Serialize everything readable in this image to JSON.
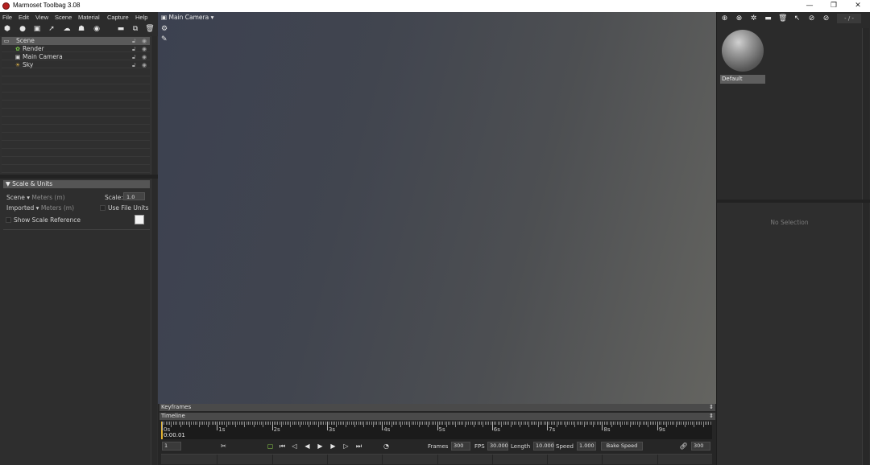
{
  "window": {
    "title": "Marmoset Toolbag 3.08",
    "controls": [
      "—",
      "❐",
      "✕"
    ]
  },
  "menu": [
    "File",
    "Edit",
    "View",
    "Scene",
    "Material",
    "Capture",
    "Help"
  ],
  "scene_tree": {
    "nodes": [
      {
        "label": "Scene",
        "icon": "scene-icon",
        "selected": true
      },
      {
        "label": "Render",
        "icon": "render-icon"
      },
      {
        "label": "Main Camera",
        "icon": "camera-icon"
      },
      {
        "label": "Sky",
        "icon": "sky-icon"
      }
    ]
  },
  "scale_units": {
    "header": "Scale & Units",
    "scene_label": "Scene",
    "scene_unit": "Meters (m)",
    "scale_label": "Scale:",
    "scale_value": "1.0",
    "imported_label": "Imported",
    "imported_unit": "Meters (m)",
    "use_file_units": "Use File Units",
    "show_scale_reference": "Show Scale Reference"
  },
  "viewport": {
    "camera": "Main Camera"
  },
  "timeline": {
    "keyframes_label": "Keyframes",
    "timeline_label": "Timeline",
    "time_labels": [
      "0s",
      "1s",
      "2s",
      "3s",
      "4s",
      "5s",
      "6s",
      "7s",
      "8s",
      "9s"
    ],
    "current_time": "0:00.01",
    "current_frame": "1",
    "frames_label": "Frames",
    "frames_value": "300",
    "fps_label": "FPS",
    "fps_value": "30.000",
    "length_label": "Length",
    "length_value": "10.000",
    "speed_label": "Speed",
    "speed_value": "1.000",
    "bake_speed_label": "Bake Speed",
    "end_frame": "300"
  },
  "materials": {
    "sort_label": "- / -",
    "items": [
      {
        "name": "Default"
      }
    ]
  },
  "properties": {
    "empty_text": "No Selection"
  }
}
